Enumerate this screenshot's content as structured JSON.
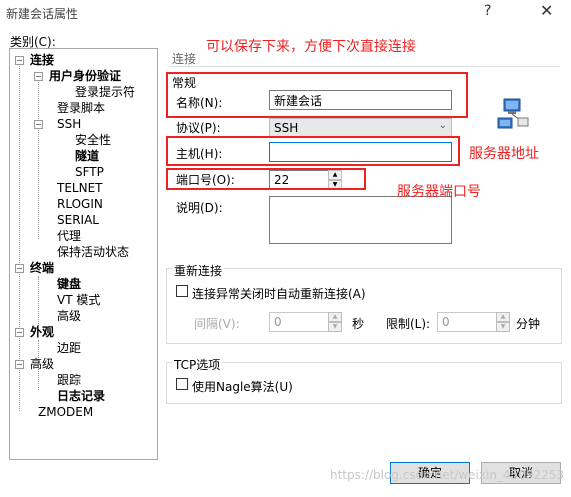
{
  "window": {
    "title": "新建会话属性",
    "help_glyph": "?",
    "close_glyph": "✕"
  },
  "category_label": "类别(C):",
  "tree": [
    {
      "label": "连接",
      "bold": true
    },
    {
      "label": "用户身份验证",
      "bold": true
    },
    {
      "label": "登录提示符",
      "bold": false
    },
    {
      "label": "登录脚本",
      "bold": false
    },
    {
      "label": "SSH",
      "bold": false
    },
    {
      "label": "安全性",
      "bold": false
    },
    {
      "label": "隧道",
      "bold": true
    },
    {
      "label": "SFTP",
      "bold": false
    },
    {
      "label": "TELNET",
      "bold": false
    },
    {
      "label": "RLOGIN",
      "bold": false
    },
    {
      "label": "SERIAL",
      "bold": false
    },
    {
      "label": "代理",
      "bold": false
    },
    {
      "label": "保持活动状态",
      "bold": false
    },
    {
      "label": "终端",
      "bold": true
    },
    {
      "label": "键盘",
      "bold": true
    },
    {
      "label": "VT 模式",
      "bold": false
    },
    {
      "label": "高级",
      "bold": false
    },
    {
      "label": "外观",
      "bold": true
    },
    {
      "label": "边距",
      "bold": false
    },
    {
      "label": "高级",
      "bold": false
    },
    {
      "label": "跟踪",
      "bold": false
    },
    {
      "label": "日志记录",
      "bold": true
    },
    {
      "label": "ZMODEM",
      "bold": false
    }
  ],
  "header": {
    "title": "连接"
  },
  "general": {
    "group_title": "常规",
    "name_label": "名称(N):",
    "name_value": "新建会话",
    "protocol_label": "协议(P):",
    "protocol_value": "SSH",
    "host_label": "主机(H):",
    "host_value": "",
    "port_label": "端口号(O):",
    "port_value": "22",
    "desc_label": "说明(D):",
    "desc_value": ""
  },
  "reconnect": {
    "group_title": "重新连接",
    "auto_label": "连接异常关闭时自动重新连接(A)",
    "interval_label": "间隔(V):",
    "interval_value": "0",
    "seconds_label": "秒",
    "limit_label": "限制(L):",
    "limit_value": "0",
    "minutes_label": "分钟"
  },
  "tcp": {
    "group_title": "TCP选项",
    "nagle_label": "使用Nagle算法(U)"
  },
  "buttons": {
    "ok": "确定",
    "cancel": "取消"
  },
  "annotations": {
    "top_note": "可以保存下来，方便下次直接连接",
    "host_note": "服务器地址",
    "port_note": "服务器端口号"
  },
  "watermark": "https://blog.csdn.net/weixin_45092253",
  "colors": {
    "annotation_red": "#ee2222",
    "focus_blue": "#0078d7"
  }
}
